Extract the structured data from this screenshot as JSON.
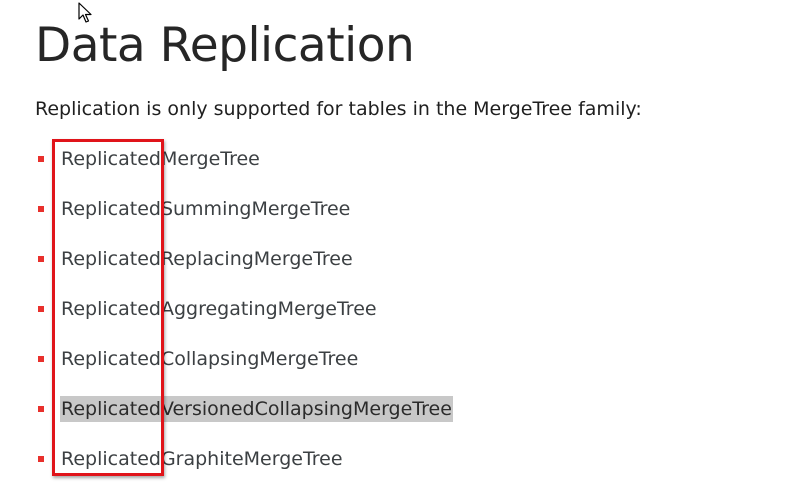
{
  "page": {
    "title": "Data Replication",
    "intro": "Replication is only supported for tables in the MergeTree family:"
  },
  "engines": [
    {
      "label": "ReplicatedMergeTree",
      "highlighted": false
    },
    {
      "label": "ReplicatedSummingMergeTree",
      "highlighted": false
    },
    {
      "label": "ReplicatedReplacingMergeTree",
      "highlighted": false
    },
    {
      "label": "ReplicatedAggregatingMergeTree",
      "highlighted": false
    },
    {
      "label": "ReplicatedCollapsingMergeTree",
      "highlighted": false
    },
    {
      "label": "ReplicatedVersionedCollapsingMergeTree",
      "highlighted": true
    },
    {
      "label": "ReplicatedGraphiteMergeTree",
      "highlighted": false
    }
  ],
  "colors": {
    "bullet": "#e8302c",
    "annotation_box": "#e0141a",
    "selection": "#c8c8c8"
  },
  "icons": {
    "cursor": "mouse-pointer-icon"
  }
}
